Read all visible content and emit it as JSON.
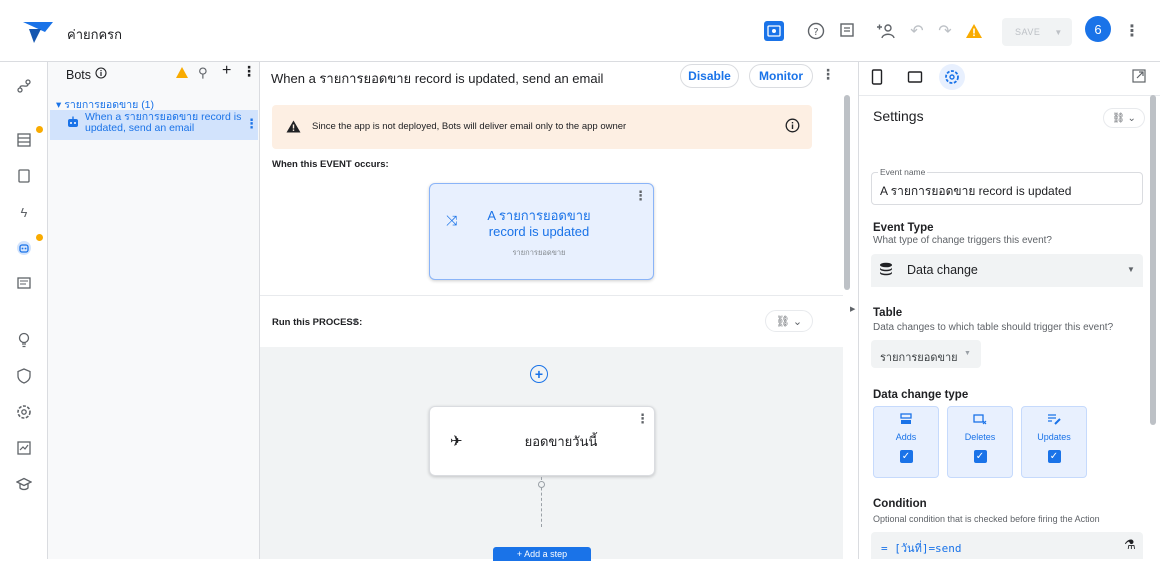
{
  "app": {
    "title": "ค่ายกครก"
  },
  "toolbar": {
    "save_label": "SAVE",
    "avatar_initial": "6"
  },
  "bots_panel": {
    "title": "Bots",
    "group_label": "▾ รายการยอดขาย (1)",
    "bot_item": "When a รายการยอดขาย record is updated, send an email"
  },
  "center": {
    "bot_title": "When a รายการยอดขาย record is updated, send an email",
    "disable_label": "Disable",
    "monitor_label": "Monitor",
    "warning_text": "Since the app is not deployed, Bots will deliver email only to the app owner",
    "event_header": "When this EVENT occurs:",
    "event_card_title": "A รายการยอดขาย record is updated",
    "event_card_sub": "รายการยอดขาย",
    "process_header": "Run this PROCESS:",
    "step_title": "ยอดขายวันนี้",
    "add_step_label": "+  Add a step"
  },
  "settings": {
    "title": "Settings",
    "event_name_label": "Event name",
    "event_name_value": "A รายการยอดขาย record is updated",
    "event_type_label": "Event Type",
    "event_type_help": "What type of change triggers this event?",
    "event_type_value": "Data change",
    "table_label": "Table",
    "table_help": "Data changes to which table should trigger this event?",
    "table_value": "รายการยอดขาย",
    "dct_label": "Data change type",
    "dct_options": [
      {
        "label": "Adds",
        "checked": true
      },
      {
        "label": "Deletes",
        "checked": true
      },
      {
        "label": "Updates",
        "checked": true
      }
    ],
    "condition_label": "Condition",
    "condition_help": "Optional condition that is checked before firing the Action",
    "condition_value": "= [วันที่]=send"
  },
  "colors": {
    "accent": "#1a73e8",
    "warning": "#f9ab00",
    "warning_bg": "#fdefe3",
    "selected_bg": "#d2e3fc"
  }
}
